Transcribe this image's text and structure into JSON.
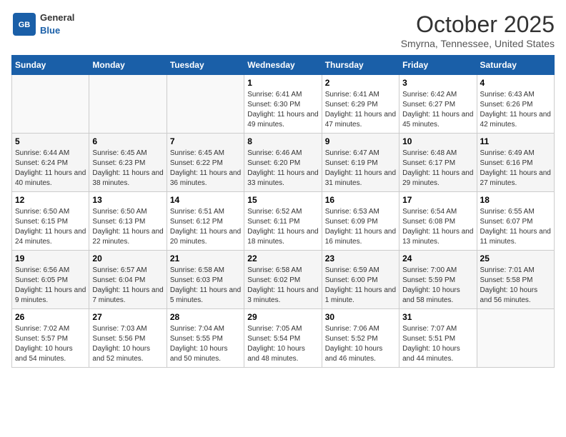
{
  "header": {
    "logo": {
      "general": "General",
      "blue": "Blue"
    },
    "title": "October 2025",
    "location": "Smyrna, Tennessee, United States"
  },
  "weekdays": [
    "Sunday",
    "Monday",
    "Tuesday",
    "Wednesday",
    "Thursday",
    "Friday",
    "Saturday"
  ],
  "weeks": [
    [
      {
        "day": "",
        "detail": ""
      },
      {
        "day": "",
        "detail": ""
      },
      {
        "day": "",
        "detail": ""
      },
      {
        "day": "1",
        "detail": "Sunrise: 6:41 AM\nSunset: 6:30 PM\nDaylight: 11 hours\nand 49 minutes."
      },
      {
        "day": "2",
        "detail": "Sunrise: 6:41 AM\nSunset: 6:29 PM\nDaylight: 11 hours\nand 47 minutes."
      },
      {
        "day": "3",
        "detail": "Sunrise: 6:42 AM\nSunset: 6:27 PM\nDaylight: 11 hours\nand 45 minutes."
      },
      {
        "day": "4",
        "detail": "Sunrise: 6:43 AM\nSunset: 6:26 PM\nDaylight: 11 hours\nand 42 minutes."
      }
    ],
    [
      {
        "day": "5",
        "detail": "Sunrise: 6:44 AM\nSunset: 6:24 PM\nDaylight: 11 hours\nand 40 minutes."
      },
      {
        "day": "6",
        "detail": "Sunrise: 6:45 AM\nSunset: 6:23 PM\nDaylight: 11 hours\nand 38 minutes."
      },
      {
        "day": "7",
        "detail": "Sunrise: 6:45 AM\nSunset: 6:22 PM\nDaylight: 11 hours\nand 36 minutes."
      },
      {
        "day": "8",
        "detail": "Sunrise: 6:46 AM\nSunset: 6:20 PM\nDaylight: 11 hours\nand 33 minutes."
      },
      {
        "day": "9",
        "detail": "Sunrise: 6:47 AM\nSunset: 6:19 PM\nDaylight: 11 hours\nand 31 minutes."
      },
      {
        "day": "10",
        "detail": "Sunrise: 6:48 AM\nSunset: 6:17 PM\nDaylight: 11 hours\nand 29 minutes."
      },
      {
        "day": "11",
        "detail": "Sunrise: 6:49 AM\nSunset: 6:16 PM\nDaylight: 11 hours\nand 27 minutes."
      }
    ],
    [
      {
        "day": "12",
        "detail": "Sunrise: 6:50 AM\nSunset: 6:15 PM\nDaylight: 11 hours\nand 24 minutes."
      },
      {
        "day": "13",
        "detail": "Sunrise: 6:50 AM\nSunset: 6:13 PM\nDaylight: 11 hours\nand 22 minutes."
      },
      {
        "day": "14",
        "detail": "Sunrise: 6:51 AM\nSunset: 6:12 PM\nDaylight: 11 hours\nand 20 minutes."
      },
      {
        "day": "15",
        "detail": "Sunrise: 6:52 AM\nSunset: 6:11 PM\nDaylight: 11 hours\nand 18 minutes."
      },
      {
        "day": "16",
        "detail": "Sunrise: 6:53 AM\nSunset: 6:09 PM\nDaylight: 11 hours\nand 16 minutes."
      },
      {
        "day": "17",
        "detail": "Sunrise: 6:54 AM\nSunset: 6:08 PM\nDaylight: 11 hours\nand 13 minutes."
      },
      {
        "day": "18",
        "detail": "Sunrise: 6:55 AM\nSunset: 6:07 PM\nDaylight: 11 hours\nand 11 minutes."
      }
    ],
    [
      {
        "day": "19",
        "detail": "Sunrise: 6:56 AM\nSunset: 6:05 PM\nDaylight: 11 hours\nand 9 minutes."
      },
      {
        "day": "20",
        "detail": "Sunrise: 6:57 AM\nSunset: 6:04 PM\nDaylight: 11 hours\nand 7 minutes."
      },
      {
        "day": "21",
        "detail": "Sunrise: 6:58 AM\nSunset: 6:03 PM\nDaylight: 11 hours\nand 5 minutes."
      },
      {
        "day": "22",
        "detail": "Sunrise: 6:58 AM\nSunset: 6:02 PM\nDaylight: 11 hours\nand 3 minutes."
      },
      {
        "day": "23",
        "detail": "Sunrise: 6:59 AM\nSunset: 6:00 PM\nDaylight: 11 hours\nand 1 minute."
      },
      {
        "day": "24",
        "detail": "Sunrise: 7:00 AM\nSunset: 5:59 PM\nDaylight: 10 hours\nand 58 minutes."
      },
      {
        "day": "25",
        "detail": "Sunrise: 7:01 AM\nSunset: 5:58 PM\nDaylight: 10 hours\nand 56 minutes."
      }
    ],
    [
      {
        "day": "26",
        "detail": "Sunrise: 7:02 AM\nSunset: 5:57 PM\nDaylight: 10 hours\nand 54 minutes."
      },
      {
        "day": "27",
        "detail": "Sunrise: 7:03 AM\nSunset: 5:56 PM\nDaylight: 10 hours\nand 52 minutes."
      },
      {
        "day": "28",
        "detail": "Sunrise: 7:04 AM\nSunset: 5:55 PM\nDaylight: 10 hours\nand 50 minutes."
      },
      {
        "day": "29",
        "detail": "Sunrise: 7:05 AM\nSunset: 5:54 PM\nDaylight: 10 hours\nand 48 minutes."
      },
      {
        "day": "30",
        "detail": "Sunrise: 7:06 AM\nSunset: 5:52 PM\nDaylight: 10 hours\nand 46 minutes."
      },
      {
        "day": "31",
        "detail": "Sunrise: 7:07 AM\nSunset: 5:51 PM\nDaylight: 10 hours\nand 44 minutes."
      },
      {
        "day": "",
        "detail": ""
      }
    ]
  ]
}
